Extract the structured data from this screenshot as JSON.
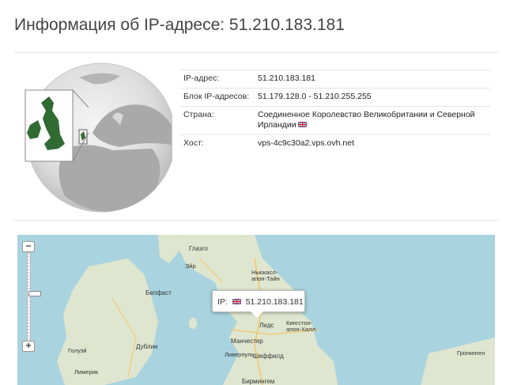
{
  "page": {
    "title": "Информация об IP-адресе: 51.210.183.181"
  },
  "info": {
    "rows": [
      {
        "label": "IP-адрес:",
        "value": "51.210.183.181"
      },
      {
        "label": "Блок IP-адресов:",
        "value": "51.179.128.0 - 51.210.255.255"
      },
      {
        "label": "Страна:",
        "value": "Соединенное Королевство Великобритании и Северной Ирландии"
      },
      {
        "label": "Хост:",
        "value": "vps-4c9c30a2.vps.ovh.net"
      }
    ]
  },
  "map": {
    "zoom_in": "+",
    "zoom_out": "−",
    "popup": {
      "prefix": "IP:",
      "ip": "51.210.183.181"
    },
    "cities": {
      "glasgow": "Глазго",
      "ayr": "Эйр",
      "newcastle": "Ньюкасл-апон-Тайн",
      "belfast": "Белфаст",
      "leeds": "Лидс",
      "kingston": "Кингстон-апон-Халл",
      "manchester": "Манчестер",
      "liverpool": "Ливерпуль",
      "sheffield": "Шеффилд",
      "dublin": "Дублин",
      "galway": "Голуэй",
      "limerick": "Лимерик",
      "birmingham": "Бирмингем",
      "groningen": "Гронинген"
    }
  },
  "colors": {
    "land": "#dfe6cf",
    "sea": "#a9d3df",
    "globe_highlight": "#2f6b33"
  }
}
